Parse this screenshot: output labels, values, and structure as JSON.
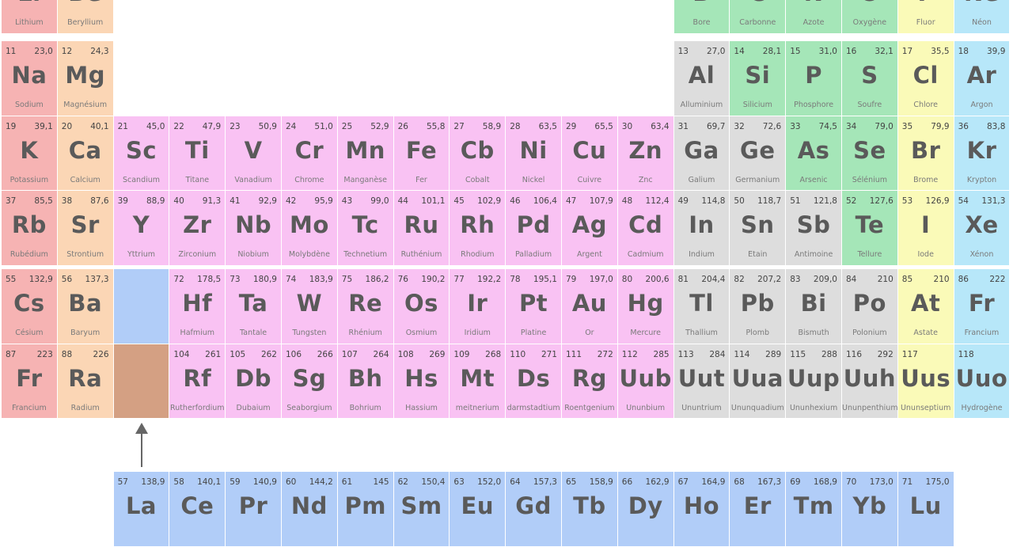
{
  "colors": {
    "alkali": "#f6b3b3",
    "alkaline_earth": "#fbd6b5",
    "transition": "#f9c2f3",
    "post_transition": "#dddddd",
    "nonmetal": "#a5e6b8",
    "halogen": "#fafab8",
    "noble_gas": "#b7e7f9",
    "lanthanide": "#b1cdf8",
    "actinide": "#d4a083"
  },
  "special_blocks": [
    {
      "name": "lanthanide-placeholder",
      "group": "lanthanide"
    },
    {
      "name": "actinide-placeholder",
      "group": "actinide"
    }
  ],
  "elements": [
    {
      "sym": "Li",
      "name": "Lithium",
      "num": "",
      "mass": "",
      "group": "alkali"
    },
    {
      "sym": "Be",
      "name": "Beryllium",
      "num": "",
      "mass": "",
      "group": "alkaline_earth"
    },
    {
      "sym": "B",
      "name": "Bore",
      "num": "",
      "mass": "",
      "group": "nonmetal"
    },
    {
      "sym": "C",
      "name": "Carbonne",
      "num": "",
      "mass": "",
      "group": "nonmetal"
    },
    {
      "sym": "N",
      "name": "Azote",
      "num": "",
      "mass": "",
      "group": "nonmetal"
    },
    {
      "sym": "O",
      "name": "Oxygène",
      "num": "",
      "mass": "",
      "group": "nonmetal"
    },
    {
      "sym": "F",
      "name": "Fluor",
      "num": "",
      "mass": "",
      "group": "halogen"
    },
    {
      "sym": "Ne",
      "name": "Néon",
      "num": "",
      "mass": "",
      "group": "noble_gas"
    },
    {
      "sym": "Na",
      "name": "Sodium",
      "num": "11",
      "mass": "23,0",
      "group": "alkali"
    },
    {
      "sym": "Mg",
      "name": "Magnésium",
      "num": "12",
      "mass": "24,3",
      "group": "alkaline_earth"
    },
    {
      "sym": "Al",
      "name": "Alluminium",
      "num": "13",
      "mass": "27,0",
      "group": "post_transition"
    },
    {
      "sym": "Si",
      "name": "Silicium",
      "num": "14",
      "mass": "28,1",
      "group": "nonmetal"
    },
    {
      "sym": "P",
      "name": "Phosphore",
      "num": "15",
      "mass": "31,0",
      "group": "nonmetal"
    },
    {
      "sym": "S",
      "name": "Soufre",
      "num": "16",
      "mass": "32,1",
      "group": "nonmetal"
    },
    {
      "sym": "Cl",
      "name": "Chlore",
      "num": "17",
      "mass": "35,5",
      "group": "halogen"
    },
    {
      "sym": "Ar",
      "name": "Argon",
      "num": "18",
      "mass": "39,9",
      "group": "noble_gas"
    },
    {
      "sym": "K",
      "name": "Potassium",
      "num": "19",
      "mass": "39,1",
      "group": "alkali"
    },
    {
      "sym": "Ca",
      "name": "Calcium",
      "num": "20",
      "mass": "40,1",
      "group": "alkaline_earth"
    },
    {
      "sym": "Sc",
      "name": "Scandium",
      "num": "21",
      "mass": "45,0",
      "group": "transition"
    },
    {
      "sym": "Ti",
      "name": "Titane",
      "num": "22",
      "mass": "47,9",
      "group": "transition"
    },
    {
      "sym": "V",
      "name": "Vanadium",
      "num": "23",
      "mass": "50,9",
      "group": "transition"
    },
    {
      "sym": "Cr",
      "name": "Chrome",
      "num": "24",
      "mass": "51,0",
      "group": "transition"
    },
    {
      "sym": "Mn",
      "name": "Manganèse",
      "num": "25",
      "mass": "52,9",
      "group": "transition"
    },
    {
      "sym": "Fe",
      "name": "Fer",
      "num": "26",
      "mass": "55,8",
      "group": "transition"
    },
    {
      "sym": "Cb",
      "name": "Cobalt",
      "num": "27",
      "mass": "58,9",
      "group": "transition"
    },
    {
      "sym": "Ni",
      "name": "Nickel",
      "num": "28",
      "mass": "63,5",
      "group": "transition"
    },
    {
      "sym": "Cu",
      "name": "Cuivre",
      "num": "29",
      "mass": "65,5",
      "group": "transition"
    },
    {
      "sym": "Zn",
      "name": "Znc",
      "num": "30",
      "mass": "63,4",
      "group": "transition"
    },
    {
      "sym": "Ga",
      "name": "Galium",
      "num": "31",
      "mass": "69,7",
      "group": "post_transition"
    },
    {
      "sym": "Ge",
      "name": "Germanium",
      "num": "32",
      "mass": "72,6",
      "group": "post_transition"
    },
    {
      "sym": "As",
      "name": "Arsenic",
      "num": "33",
      "mass": "74,5",
      "group": "nonmetal"
    },
    {
      "sym": "Se",
      "name": "Sélénium",
      "num": "34",
      "mass": "79,0",
      "group": "nonmetal"
    },
    {
      "sym": "Br",
      "name": "Brome",
      "num": "35",
      "mass": "79,9",
      "group": "halogen"
    },
    {
      "sym": "Kr",
      "name": "Krypton",
      "num": "36",
      "mass": "83,8",
      "group": "noble_gas"
    },
    {
      "sym": "Rb",
      "name": "Rubédium",
      "num": "37",
      "mass": "85,5",
      "group": "alkali"
    },
    {
      "sym": "Sr",
      "name": "Strontium",
      "num": "38",
      "mass": "87,6",
      "group": "alkaline_earth"
    },
    {
      "sym": "Y",
      "name": "Yttrium",
      "num": "39",
      "mass": "88,9",
      "group": "transition"
    },
    {
      "sym": "Zr",
      "name": "Zirconium",
      "num": "40",
      "mass": "91,3",
      "group": "transition"
    },
    {
      "sym": "Nb",
      "name": "Niobium",
      "num": "41",
      "mass": "92,9",
      "group": "transition"
    },
    {
      "sym": "Mo",
      "name": "Molybdène",
      "num": "42",
      "mass": "95,9",
      "group": "transition"
    },
    {
      "sym": "Tc",
      "name": "Technetium",
      "num": "43",
      "mass": "99,0",
      "group": "transition"
    },
    {
      "sym": "Ru",
      "name": "Ruthénium",
      "num": "44",
      "mass": "101,1",
      "group": "transition"
    },
    {
      "sym": "Rh",
      "name": "Rhodium",
      "num": "45",
      "mass": "102,9",
      "group": "transition"
    },
    {
      "sym": "Pd",
      "name": "Palladium",
      "num": "46",
      "mass": "106,4",
      "group": "transition"
    },
    {
      "sym": "Ag",
      "name": "Argent",
      "num": "47",
      "mass": "107,9",
      "group": "transition"
    },
    {
      "sym": "Cd",
      "name": "Cadmium",
      "num": "48",
      "mass": "112,4",
      "group": "transition"
    },
    {
      "sym": "In",
      "name": "Indium",
      "num": "49",
      "mass": "114,8",
      "group": "post_transition"
    },
    {
      "sym": "Sn",
      "name": "Etain",
      "num": "50",
      "mass": "118,7",
      "group": "post_transition"
    },
    {
      "sym": "Sb",
      "name": "Antimoine",
      "num": "51",
      "mass": "121,8",
      "group": "post_transition"
    },
    {
      "sym": "Te",
      "name": "Tellure",
      "num": "52",
      "mass": "127,6",
      "group": "nonmetal"
    },
    {
      "sym": "I",
      "name": "Iode",
      "num": "53",
      "mass": "126,9",
      "group": "halogen"
    },
    {
      "sym": "Xe",
      "name": "Xénon",
      "num": "54",
      "mass": "131,3",
      "group": "noble_gas"
    },
    {
      "sym": "Cs",
      "name": "Césium",
      "num": "55",
      "mass": "132,9",
      "group": "alkali"
    },
    {
      "sym": "Ba",
      "name": "Baryum",
      "num": "56",
      "mass": "137,3",
      "group": "alkaline_earth"
    },
    {
      "sym": "Hf",
      "name": "Hafmium",
      "num": "72",
      "mass": "178,5",
      "group": "transition"
    },
    {
      "sym": "Ta",
      "name": "Tantale",
      "num": "73",
      "mass": "180,9",
      "group": "transition"
    },
    {
      "sym": "W",
      "name": "Tungsten",
      "num": "74",
      "mass": "183,9",
      "group": "transition"
    },
    {
      "sym": "Re",
      "name": "Rhénium",
      "num": "75",
      "mass": "186,2",
      "group": "transition"
    },
    {
      "sym": "Os",
      "name": "Osmium",
      "num": "76",
      "mass": "190,2",
      "group": "transition"
    },
    {
      "sym": "Ir",
      "name": "Iridium",
      "num": "77",
      "mass": "192,2",
      "group": "transition"
    },
    {
      "sym": "Pt",
      "name": "Platine",
      "num": "78",
      "mass": "195,1",
      "group": "transition"
    },
    {
      "sym": "Au",
      "name": "Or",
      "num": "79",
      "mass": "197,0",
      "group": "transition"
    },
    {
      "sym": "Hg",
      "name": "Mercure",
      "num": "80",
      "mass": "200,6",
      "group": "transition"
    },
    {
      "sym": "Tl",
      "name": "Thallium",
      "num": "81",
      "mass": "204,4",
      "group": "post_transition"
    },
    {
      "sym": "Pb",
      "name": "Plomb",
      "num": "82",
      "mass": "207,2",
      "group": "post_transition"
    },
    {
      "sym": "Bi",
      "name": "Bismuth",
      "num": "83",
      "mass": "209,0",
      "group": "post_transition"
    },
    {
      "sym": "Po",
      "name": "Polonium",
      "num": "84",
      "mass": "210",
      "group": "post_transition"
    },
    {
      "sym": "At",
      "name": "Astate",
      "num": "85",
      "mass": "210",
      "group": "halogen"
    },
    {
      "sym": "Fr",
      "name": "Francium",
      "num": "86",
      "mass": "222",
      "group": "noble_gas"
    },
    {
      "sym": "Fr",
      "name": "Francium",
      "num": "87",
      "mass": "223",
      "group": "alkali"
    },
    {
      "sym": "Ra",
      "name": "Radium",
      "num": "88",
      "mass": "226",
      "group": "alkaline_earth"
    },
    {
      "sym": "Rf",
      "name": "Rutherfordium",
      "num": "104",
      "mass": "261",
      "group": "transition"
    },
    {
      "sym": "Db",
      "name": "Dubaium",
      "num": "105",
      "mass": "262",
      "group": "transition"
    },
    {
      "sym": "Sg",
      "name": "Seaborgium",
      "num": "106",
      "mass": "266",
      "group": "transition"
    },
    {
      "sym": "Bh",
      "name": "Bohrium",
      "num": "107",
      "mass": "264",
      "group": "transition"
    },
    {
      "sym": "Hs",
      "name": "Hassium",
      "num": "108",
      "mass": "269",
      "group": "transition"
    },
    {
      "sym": "Mt",
      "name": "meitnerium",
      "num": "109",
      "mass": "268",
      "group": "transition"
    },
    {
      "sym": "Ds",
      "name": "darmstadtium",
      "num": "110",
      "mass": "271",
      "group": "transition"
    },
    {
      "sym": "Rg",
      "name": "Roentgenium",
      "num": "111",
      "mass": "272",
      "group": "transition"
    },
    {
      "sym": "Uub",
      "name": "Ununbium",
      "num": "112",
      "mass": "285",
      "group": "transition"
    },
    {
      "sym": "Uut",
      "name": "Ununtrium",
      "num": "113",
      "mass": "284",
      "group": "post_transition"
    },
    {
      "sym": "Uua",
      "name": "Ununquadium",
      "num": "114",
      "mass": "289",
      "group": "post_transition"
    },
    {
      "sym": "Uup",
      "name": "Ununhexium",
      "num": "115",
      "mass": "288",
      "group": "post_transition"
    },
    {
      "sym": "Uuh",
      "name": "Ununpenthium",
      "num": "116",
      "mass": "292",
      "group": "post_transition"
    },
    {
      "sym": "Uus",
      "name": "Ununseptium",
      "num": "117",
      "mass": "",
      "group": "halogen"
    },
    {
      "sym": "Uuo",
      "name": "Hydrogène",
      "num": "118",
      "mass": "",
      "group": "noble_gas"
    },
    {
      "sym": "La",
      "name": "",
      "num": "57",
      "mass": "138,9",
      "group": "lanthanide"
    },
    {
      "sym": "Ce",
      "name": "",
      "num": "58",
      "mass": "140,1",
      "group": "lanthanide"
    },
    {
      "sym": "Pr",
      "name": "",
      "num": "59",
      "mass": "140,9",
      "group": "lanthanide"
    },
    {
      "sym": "Nd",
      "name": "",
      "num": "60",
      "mass": "144,2",
      "group": "lanthanide"
    },
    {
      "sym": "Pm",
      "name": "",
      "num": "61",
      "mass": "145",
      "group": "lanthanide"
    },
    {
      "sym": "Sm",
      "name": "",
      "num": "62",
      "mass": "150,4",
      "group": "lanthanide"
    },
    {
      "sym": "Eu",
      "name": "",
      "num": "63",
      "mass": "152,0",
      "group": "lanthanide"
    },
    {
      "sym": "Gd",
      "name": "",
      "num": "64",
      "mass": "157,3",
      "group": "lanthanide"
    },
    {
      "sym": "Tb",
      "name": "",
      "num": "65",
      "mass": "158,9",
      "group": "lanthanide"
    },
    {
      "sym": "Dy",
      "name": "",
      "num": "66",
      "mass": "162,9",
      "group": "lanthanide"
    },
    {
      "sym": "Ho",
      "name": "",
      "num": "67",
      "mass": "164,9",
      "group": "lanthanide"
    },
    {
      "sym": "Er",
      "name": "",
      "num": "68",
      "mass": "167,3",
      "group": "lanthanide"
    },
    {
      "sym": "Tm",
      "name": "",
      "num": "69",
      "mass": "168,9",
      "group": "lanthanide"
    },
    {
      "sym": "Yb",
      "name": "",
      "num": "70",
      "mass": "173,0",
      "group": "lanthanide"
    },
    {
      "sym": "Lu",
      "name": "",
      "num": "71",
      "mass": "175,0",
      "group": "lanthanide"
    }
  ]
}
